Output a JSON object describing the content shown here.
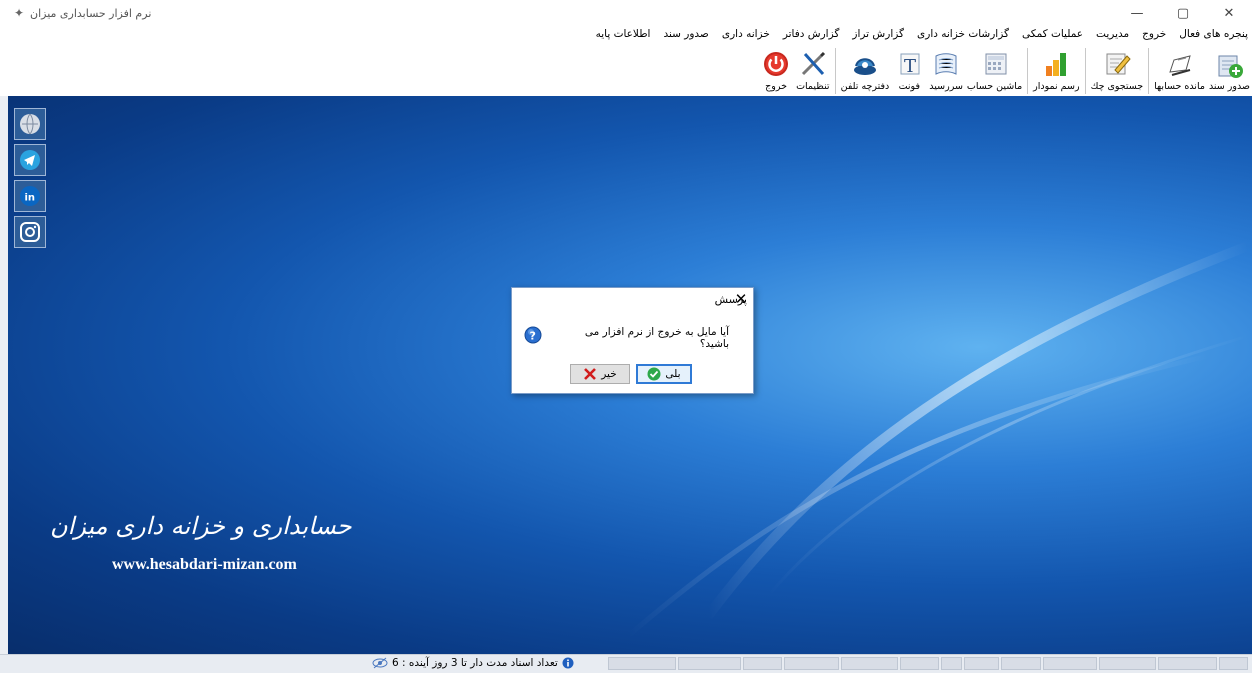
{
  "window": {
    "title": "نرم افزار حسابداری میزان",
    "minimize": "—",
    "maximize": "▢",
    "close": "✕"
  },
  "menu": [
    "اطلاعات پایه",
    "صدور سند",
    "خزانه داری",
    "گزارش دفاتر",
    "گزارش تراز",
    "گزارشات خزانه داری",
    "عملیات کمکی",
    "مدیریت",
    "خروج",
    "پنجره های فعال"
  ],
  "toolbar": {
    "group1": [
      {
        "label": "صدور سند",
        "icon": "add-document-icon"
      },
      {
        "label": "مانده حسابها",
        "icon": "account-balance-icon"
      },
      {
        "label": "جستجوی چك",
        "icon": "check-search-icon"
      },
      {
        "label": "رسم نمودار",
        "icon": "bar-chart-icon"
      },
      {
        "label": "ماشین حساب",
        "icon": "calculator-icon"
      },
      {
        "label": "سررسید",
        "icon": "calendar-icon"
      },
      {
        "label": "فونت",
        "icon": "font-icon"
      },
      {
        "label": "دفترچه تلفن",
        "icon": "phone-book-icon"
      },
      {
        "label": "تنظیمات",
        "icon": "settings-tools-icon"
      },
      {
        "label": "خروج",
        "icon": "power-icon"
      }
    ]
  },
  "social": [
    "website-icon",
    "telegram-icon",
    "linkedin-icon",
    "instagram-icon"
  ],
  "brand": {
    "text": "حسابداری و خزانه داری میزان",
    "url": "www.hesabdari-mizan.com"
  },
  "dialog": {
    "title": "پرسش",
    "message": "آیا مایل به خروج از نرم افزار می باشید؟",
    "yes": "بلی",
    "no": "خیر"
  },
  "status": {
    "text": "تعداد اسناد مدت دار تا 3 روز آینده : 6"
  },
  "colors": {
    "desktop": "#1356ae",
    "accent": "#2f7ad6"
  }
}
